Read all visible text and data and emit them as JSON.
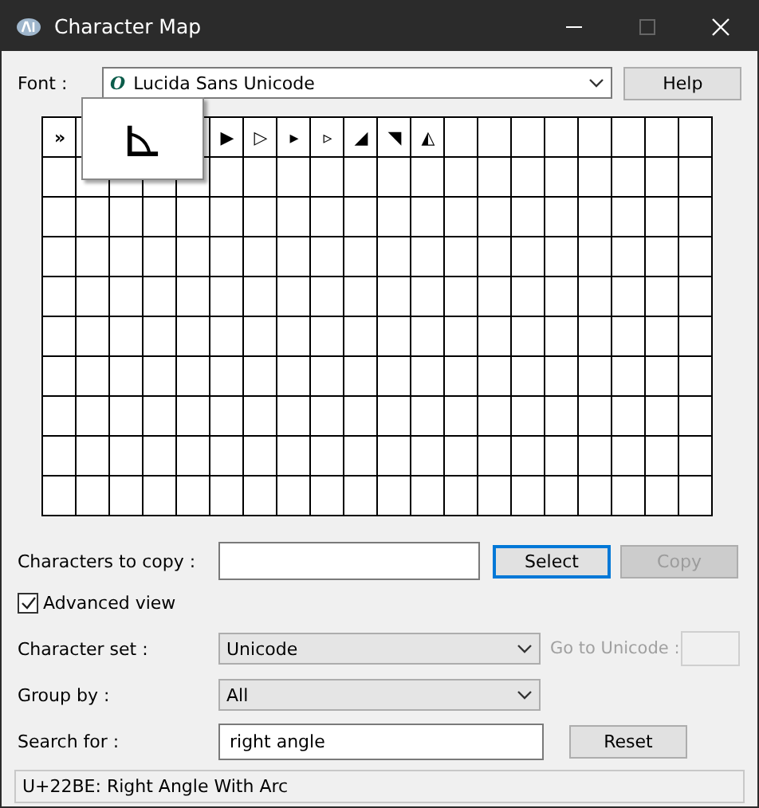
{
  "window": {
    "title": "Character Map"
  },
  "font": {
    "label": "Font :",
    "value": "Lucida Sans Unicode",
    "glyph": "O"
  },
  "help_button": "Help",
  "grid": {
    "chars_before_magnifier": [
      "»"
    ],
    "chars_after_magnifier": [
      "▶",
      "▷",
      "▸",
      "▹",
      "◢",
      "◥",
      "◭"
    ],
    "zoom_char": "⊾"
  },
  "copy": {
    "label": "Characters to copy :",
    "select": "Select",
    "copy": "Copy",
    "copy_disabled": true
  },
  "advanced_view": {
    "label": "Advanced view",
    "checked": true
  },
  "character_set": {
    "label": "Character set :",
    "value": "Unicode",
    "goto_label": "Go to Unicode :",
    "goto_disabled": true
  },
  "group_by": {
    "label": "Group by :",
    "value": "All"
  },
  "search": {
    "label": "Search for :",
    "value": "right angle",
    "reset": "Reset"
  },
  "status_bar": "U+22BE: Right Angle With Arc"
}
